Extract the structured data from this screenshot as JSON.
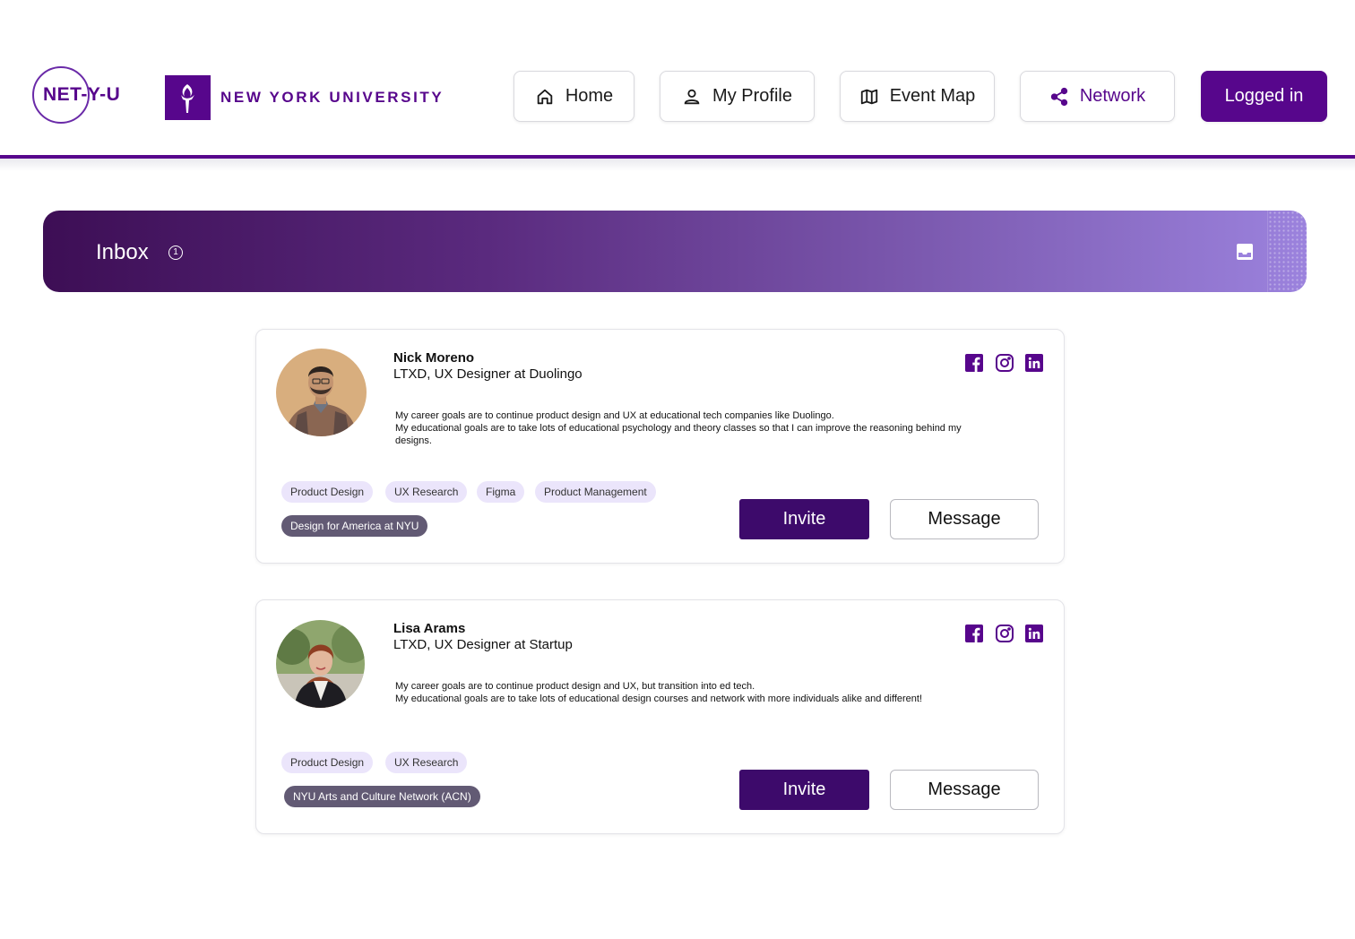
{
  "brand": {
    "app_logo": "NET-Y-U",
    "university": "NEW YORK UNIVERSITY",
    "primary_color": "#57068c"
  },
  "nav": {
    "home": {
      "label": "Home",
      "icon": "home-icon"
    },
    "profile": {
      "label": "My Profile",
      "icon": "user-icon"
    },
    "event_map": {
      "label": "Event Map",
      "icon": "map-icon"
    },
    "network": {
      "label": "Network",
      "icon": "share-icon",
      "active": true
    },
    "logged_in": {
      "label": "Logged in"
    }
  },
  "banner": {
    "title": "Inbox",
    "info_glyph": "1",
    "icon": "inbox-tray-icon"
  },
  "cards": [
    {
      "name": "Nick Moreno",
      "role": "LTXD, UX Designer at Duolingo",
      "goals_line1": "My career goals are to continue product design and UX at educational tech companies like Duolingo.",
      "goals_line2": "My educational goals are to take lots of educational psychology and theory classes so that I can improve the reasoning behind my designs.",
      "skills": [
        "Product Design",
        "UX Research",
        "Figma",
        "Product Management"
      ],
      "club": "Design for America at NYU",
      "invite_label": "Invite",
      "message_label": "Message"
    },
    {
      "name": "Lisa Arams",
      "role": "LTXD, UX Designer at Startup",
      "goals_line1": "My career goals are to continue product design and UX, but transition into ed tech.",
      "goals_line2": "My educational goals are to take lots of educational design courses and network with more individuals alike and different!",
      "skills": [
        "Product Design",
        "UX Research"
      ],
      "club": "NYU Arts and Culture Network (ACN)",
      "invite_label": "Invite",
      "message_label": "Message"
    }
  ]
}
